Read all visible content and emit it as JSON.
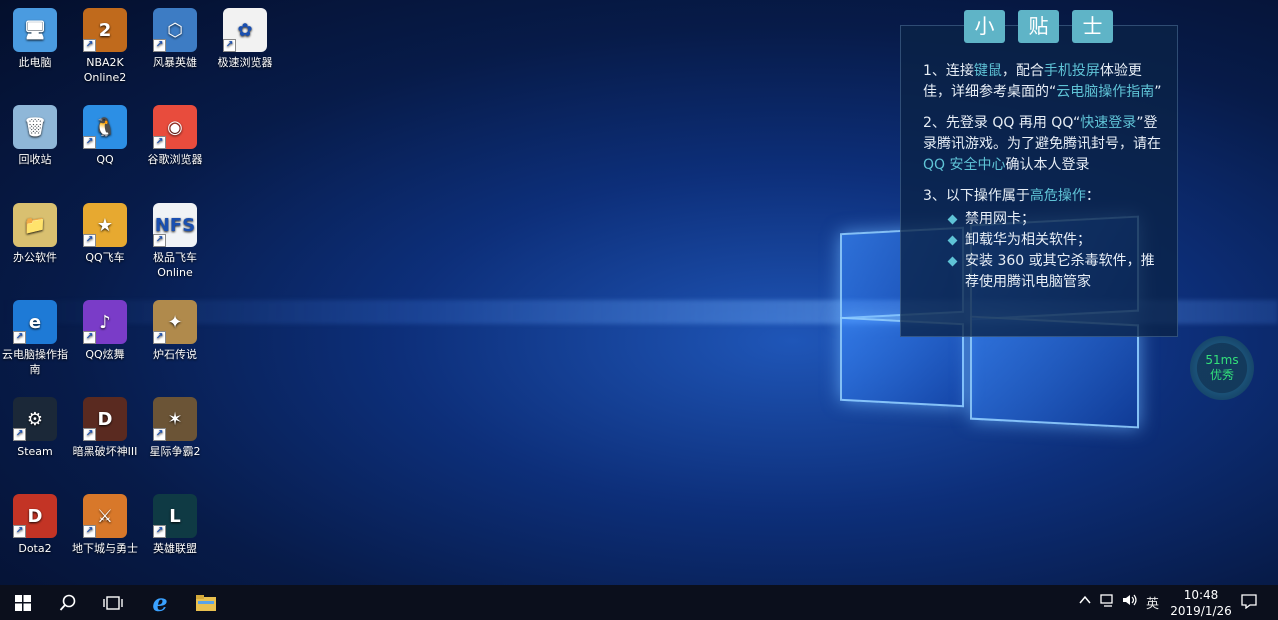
{
  "desktop_icons": [
    {
      "label": "此电脑",
      "icon": "computer-icon",
      "bg": "#4a9be0",
      "glyph": "🖥"
    },
    {
      "label": "NBA2K Online2",
      "icon": "nba2k-icon",
      "bg": "#c06a1c",
      "glyph": "2"
    },
    {
      "label": "风暴英雄",
      "icon": "heroes-storm-icon",
      "bg": "#3d7cc4",
      "glyph": "⬡"
    },
    {
      "label": "极速浏览器",
      "icon": "fast-browser-icon",
      "bg": "#f2f2f2",
      "glyph": "✿"
    },
    {
      "label": "回收站",
      "icon": "recycle-bin-icon",
      "bg": "#8fb7d8",
      "glyph": "🗑"
    },
    {
      "label": "QQ",
      "icon": "qq-icon",
      "bg": "#2c8fe5",
      "glyph": "🐧"
    },
    {
      "label": "谷歌浏览器",
      "icon": "chrome-icon",
      "bg": "#e84c3d",
      "glyph": "◉"
    },
    {
      "label": "办公软件",
      "icon": "folder-icon",
      "bg": "#d9c070",
      "glyph": "📁"
    },
    {
      "label": "QQ飞车",
      "icon": "qq-speed-icon",
      "bg": "#e7a930",
      "glyph": "★"
    },
    {
      "label": "极品飞车 Online",
      "icon": "nfs-online-icon",
      "bg": "#f0f3f6",
      "glyph": "NFS"
    },
    {
      "label": "云电脑操作指南",
      "icon": "ie-icon",
      "bg": "#1e7ad6",
      "glyph": "e"
    },
    {
      "label": "QQ炫舞",
      "icon": "qq-dance-icon",
      "bg": "#7a3cc8",
      "glyph": "♪"
    },
    {
      "label": "炉石传说",
      "icon": "hearthstone-icon",
      "bg": "#b08a4c",
      "glyph": "✦"
    },
    {
      "label": "Steam",
      "icon": "steam-icon",
      "bg": "#1b2838",
      "glyph": "⚙"
    },
    {
      "label": "暗黑破坏神III",
      "icon": "diablo3-icon",
      "bg": "#5a2a20",
      "glyph": "D"
    },
    {
      "label": "星际争霸2",
      "icon": "starcraft2-icon",
      "bg": "#6b5436",
      "glyph": "✶"
    },
    {
      "label": "Dota2",
      "icon": "dota2-icon",
      "bg": "#c33425",
      "glyph": "D"
    },
    {
      "label": "地下城与勇士",
      "icon": "dnf-icon",
      "bg": "#d8782a",
      "glyph": "⚔"
    },
    {
      "label": "英雄联盟",
      "icon": "lol-icon",
      "bg": "#0f3a44",
      "glyph": "L"
    }
  ],
  "tips": {
    "title": [
      "小",
      "贴",
      "士"
    ],
    "p1_a": "1、连接",
    "p1_b": "键鼠",
    "p1_c": "，配合",
    "p1_d": "手机投屏",
    "p1_e": "体验更佳，详细参考桌面的“",
    "p1_f": "云电脑操作指南",
    "p1_g": "”",
    "p2_a": "2、先登录 QQ 再用 QQ“",
    "p2_b": "快速登录",
    "p2_c": "”登录腾讯游戏。为了避免腾讯封号，请在",
    "p2_d": "QQ 安全中心",
    "p2_e": "确认本人登录",
    "p3_a": "3、以下操作属于",
    "p3_b": "高危操作",
    "p3_c": "：",
    "items": [
      "禁用网卡；",
      "卸载华为相关软件；",
      "安装 360 或其它杀毒软件，推荐使用腾讯电脑管家"
    ]
  },
  "ping": {
    "value": "51ms",
    "status": "优秀"
  },
  "taskbar": {
    "ime": "英",
    "time": "10:48",
    "date": "2019/1/26"
  }
}
